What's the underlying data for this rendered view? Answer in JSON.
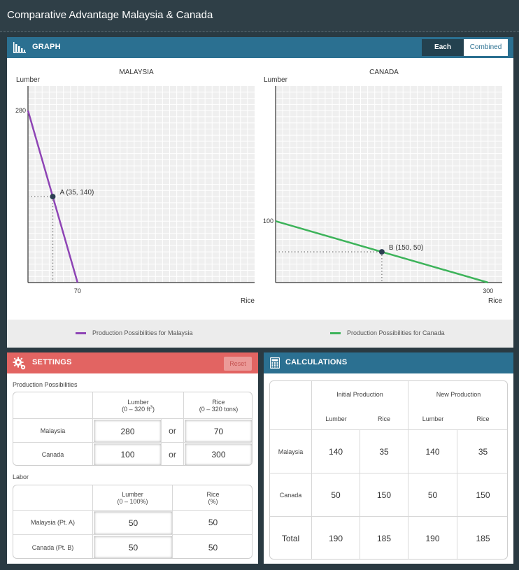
{
  "app": {
    "title": "Comparative Advantage Malaysia & Canada"
  },
  "graph_panel": {
    "title": "GRAPH",
    "icon": "bar-chart-icon",
    "toggle": {
      "each": "Each",
      "combined": "Combined",
      "selected": "Each"
    },
    "legend": [
      {
        "label": "Production Possibilities for Malaysia",
        "color": "#8e44b5"
      },
      {
        "label": "Production Possibilities for Canada",
        "color": "#3db35a"
      }
    ]
  },
  "chart_data": [
    {
      "type": "line",
      "title": "MALAYSIA",
      "xlabel": "Rice",
      "ylabel": "Lumber",
      "xlim": [
        0,
        320
      ],
      "ylim": [
        0,
        320
      ],
      "grid": true,
      "series": [
        {
          "color": "#8e44b5",
          "points": [
            [
              0,
              280
            ],
            [
              70,
              0
            ]
          ]
        }
      ],
      "point": {
        "label": "A (35, 140)",
        "x": 35,
        "y": 140
      },
      "tick_labels": {
        "x": "70",
        "y": "280"
      }
    },
    {
      "type": "line",
      "title": "CANADA",
      "xlabel": "Rice",
      "ylabel": "Lumber",
      "xlim": [
        0,
        320
      ],
      "ylim": [
        0,
        320
      ],
      "grid": true,
      "series": [
        {
          "color": "#3db35a",
          "points": [
            [
              0,
              100
            ],
            [
              300,
              0
            ]
          ]
        }
      ],
      "point": {
        "label": "B (150, 50)",
        "x": 150,
        "y": 50
      },
      "tick_labels": {
        "x": "300",
        "y": "100"
      }
    }
  ],
  "settings": {
    "title": "SETTINGS",
    "reset_label": "Reset",
    "production_label": "Production Possibilities",
    "production_headers": {
      "lumber": "Lumber",
      "lumber_range": "(0 – 320 ft",
      "lumber_sup": "3",
      "lumber_close": ")",
      "rice": "Rice",
      "rice_range": "(0 – 320 tons)"
    },
    "production_rows": [
      {
        "country": "Malaysia",
        "lumber": "280",
        "or": "or",
        "rice": "70"
      },
      {
        "country": "Canada",
        "lumber": "100",
        "or": "or",
        "rice": "300"
      }
    ],
    "labor_label": "Labor",
    "labor_headers": {
      "lumber": "Lumber",
      "lumber_range": "(0 – 100%)",
      "rice": "Rice",
      "rice_range": "(%)"
    },
    "labor_rows": [
      {
        "country": "Malaysia (Pt. A)",
        "lumber": "50",
        "rice": "50"
      },
      {
        "country": "Canada (Pt. B)",
        "lumber": "50",
        "rice": "50"
      }
    ]
  },
  "calculations": {
    "title": "CALCULATIONS",
    "initial": "Initial Production",
    "new": "New Production",
    "sub": [
      "Lumber",
      "Rice",
      "Lumber",
      "Rice"
    ],
    "rows": [
      {
        "label": "Malaysia",
        "values": [
          "140",
          "35",
          "140",
          "35"
        ]
      },
      {
        "label": "Canada",
        "values": [
          "50",
          "150",
          "50",
          "150"
        ]
      },
      {
        "label": "Total",
        "values": [
          "190",
          "185",
          "190",
          "185"
        ]
      }
    ]
  }
}
